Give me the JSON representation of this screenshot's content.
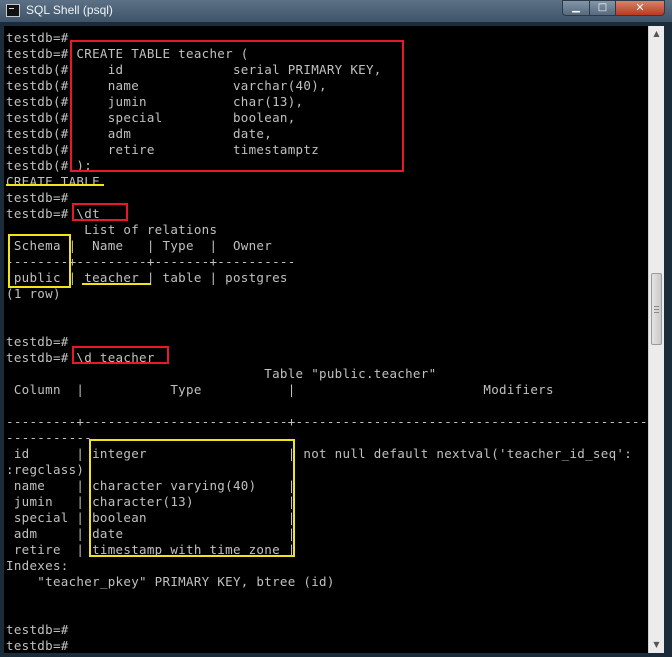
{
  "window": {
    "title": "SQL Shell (psql)",
    "min_glyph": "▁",
    "max_glyph": "□",
    "close_glyph": "✕"
  },
  "terminal": {
    "lines": [
      "testdb=#",
      "testdb=# CREATE TABLE teacher (",
      "testdb(#     id              serial PRIMARY KEY,",
      "testdb(#     name            varchar(40),",
      "testdb(#     jumin           char(13),",
      "testdb(#     special         boolean,",
      "testdb(#     adm             date,",
      "testdb(#     retire          timestamptz",
      "testdb(# );",
      "CREATE TABLE",
      "testdb=#",
      "testdb=# \\dt",
      "          List of relations",
      " Schema |  Name   | Type  |  Owner",
      "--------+---------+-------+----------",
      " public | teacher | table | postgres",
      "(1 row)",
      "",
      "",
      "testdb=#",
      "testdb=# \\d teacher",
      "                                 Table \"public.teacher\"",
      " Column  |           Type           |                        Modifiers",
      "",
      "---------+--------------------------+----------------------------------------------",
      "-----------",
      " id      | integer                  | not null default nextval('teacher_id_seq':",
      ":regclass)",
      " name    | character varying(40)    |",
      " jumin   | character(13)            |",
      " special | boolean                  |",
      " adm     | date                     |",
      " retire  | timestamp with time zone |",
      "Indexes:",
      "    \"teacher_pkey\" PRIMARY KEY, btree (id)",
      "",
      "",
      "testdb=#",
      "testdb=#"
    ]
  },
  "annotation_colors": {
    "red": "#e8182b",
    "yellow": "#f2e41a"
  }
}
